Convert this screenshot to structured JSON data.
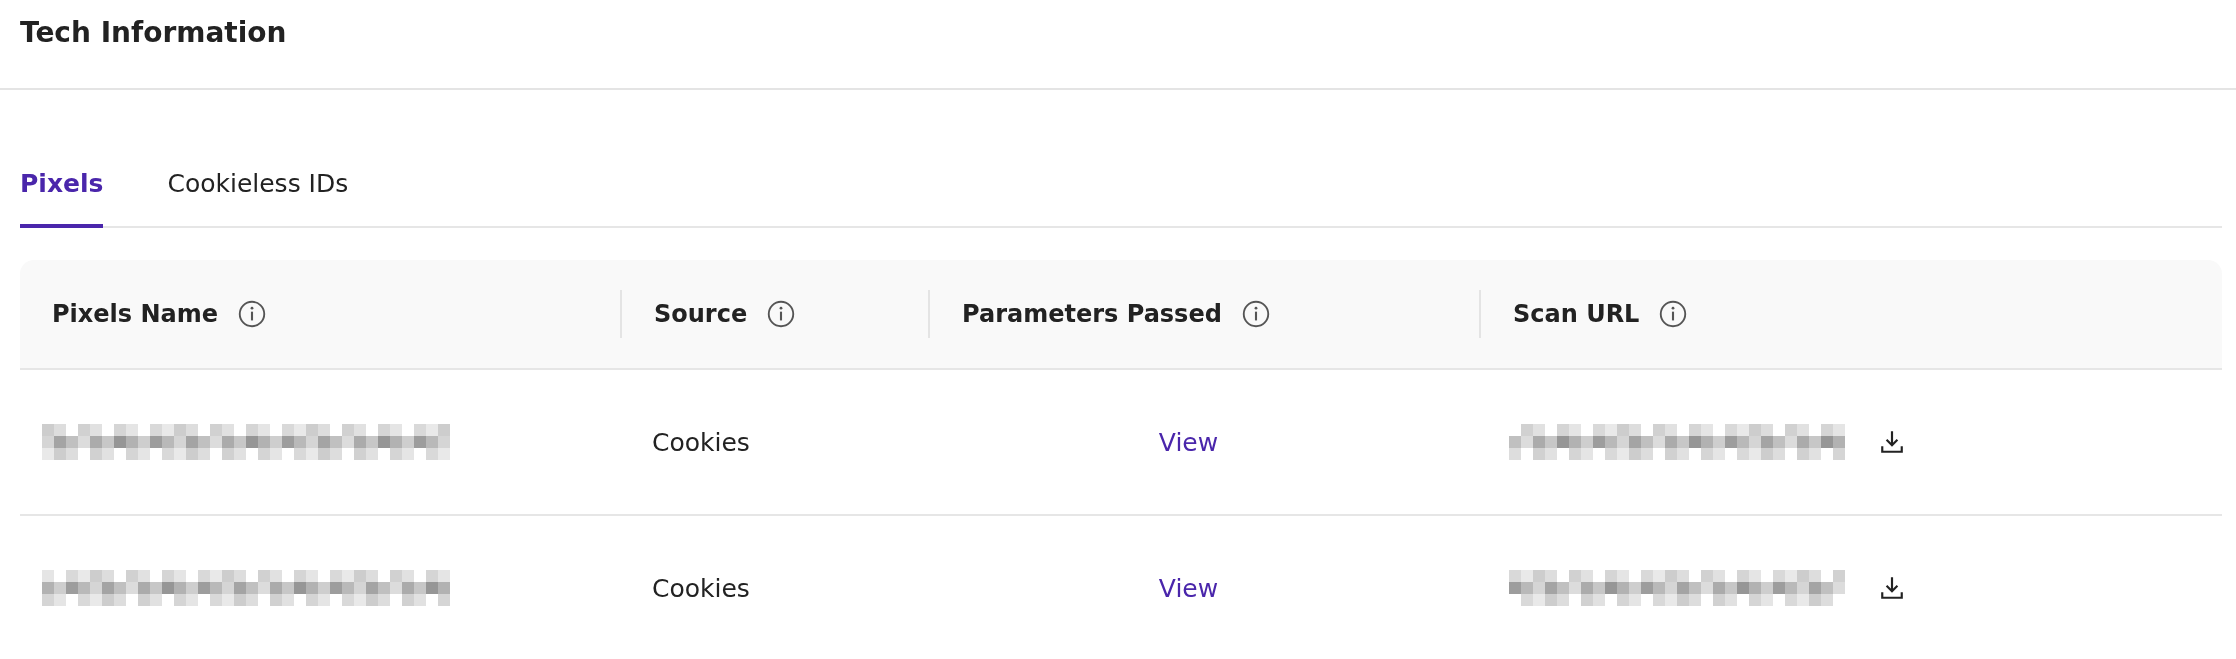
{
  "page": {
    "title": "Tech Information"
  },
  "tabs": [
    {
      "label": "Pixels",
      "selected": true
    },
    {
      "label": "Cookieless IDs",
      "selected": false
    }
  ],
  "table": {
    "columns": [
      {
        "label": "Pixels Name"
      },
      {
        "label": "Source"
      },
      {
        "label": "Parameters Passed"
      },
      {
        "label": "Scan URL"
      }
    ],
    "rows": [
      {
        "pixel_name": {
          "kind": "redacted"
        },
        "source": "Cookies",
        "parameters": "View",
        "scan_url": {
          "kind": "redacted"
        }
      },
      {
        "pixel_name": {
          "kind": "redacted"
        },
        "source": "Cookies",
        "parameters": "View",
        "scan_url": {
          "kind": "redacted"
        }
      }
    ]
  }
}
